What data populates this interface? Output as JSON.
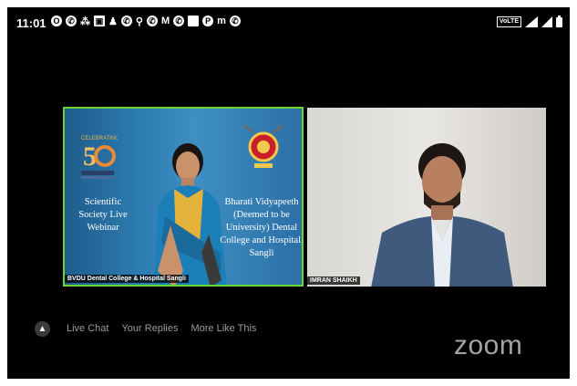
{
  "status_bar": {
    "time": "11:01",
    "notification_icons": [
      "opera-icon",
      "whatsapp-icon",
      "signal-icon",
      "screenshot-icon",
      "alert-icon",
      "whatsapp-icon",
      "link-icon",
      "whatsapp-icon",
      "gmail-icon",
      "whatsapp-icon",
      "square-icon",
      "pinterest-icon",
      "messenger-icon",
      "whatsapp-icon"
    ],
    "volte_label": "VoLTE",
    "network_icons": [
      "signal-bars-icon",
      "signal-bars-icon",
      "battery-icon"
    ]
  },
  "video_tiles": [
    {
      "name": "BVDU Dental College & Hospital Sangli",
      "active_speaker": true,
      "left_text": "Scientific Society Live Webinar",
      "right_text": "Bharati Vidyapeeth (Deemed to be University) Dental College and Hospital, Sangli"
    },
    {
      "name": "IMRAN SHAIKH",
      "active_speaker": false
    }
  ],
  "chat_bar": {
    "tabs": [
      "Live Chat",
      "Your Replies",
      "More Like This"
    ]
  },
  "brand": {
    "logo_text": "zoom"
  },
  "colors": {
    "active_border": "#6cd331",
    "background": "#000000"
  }
}
